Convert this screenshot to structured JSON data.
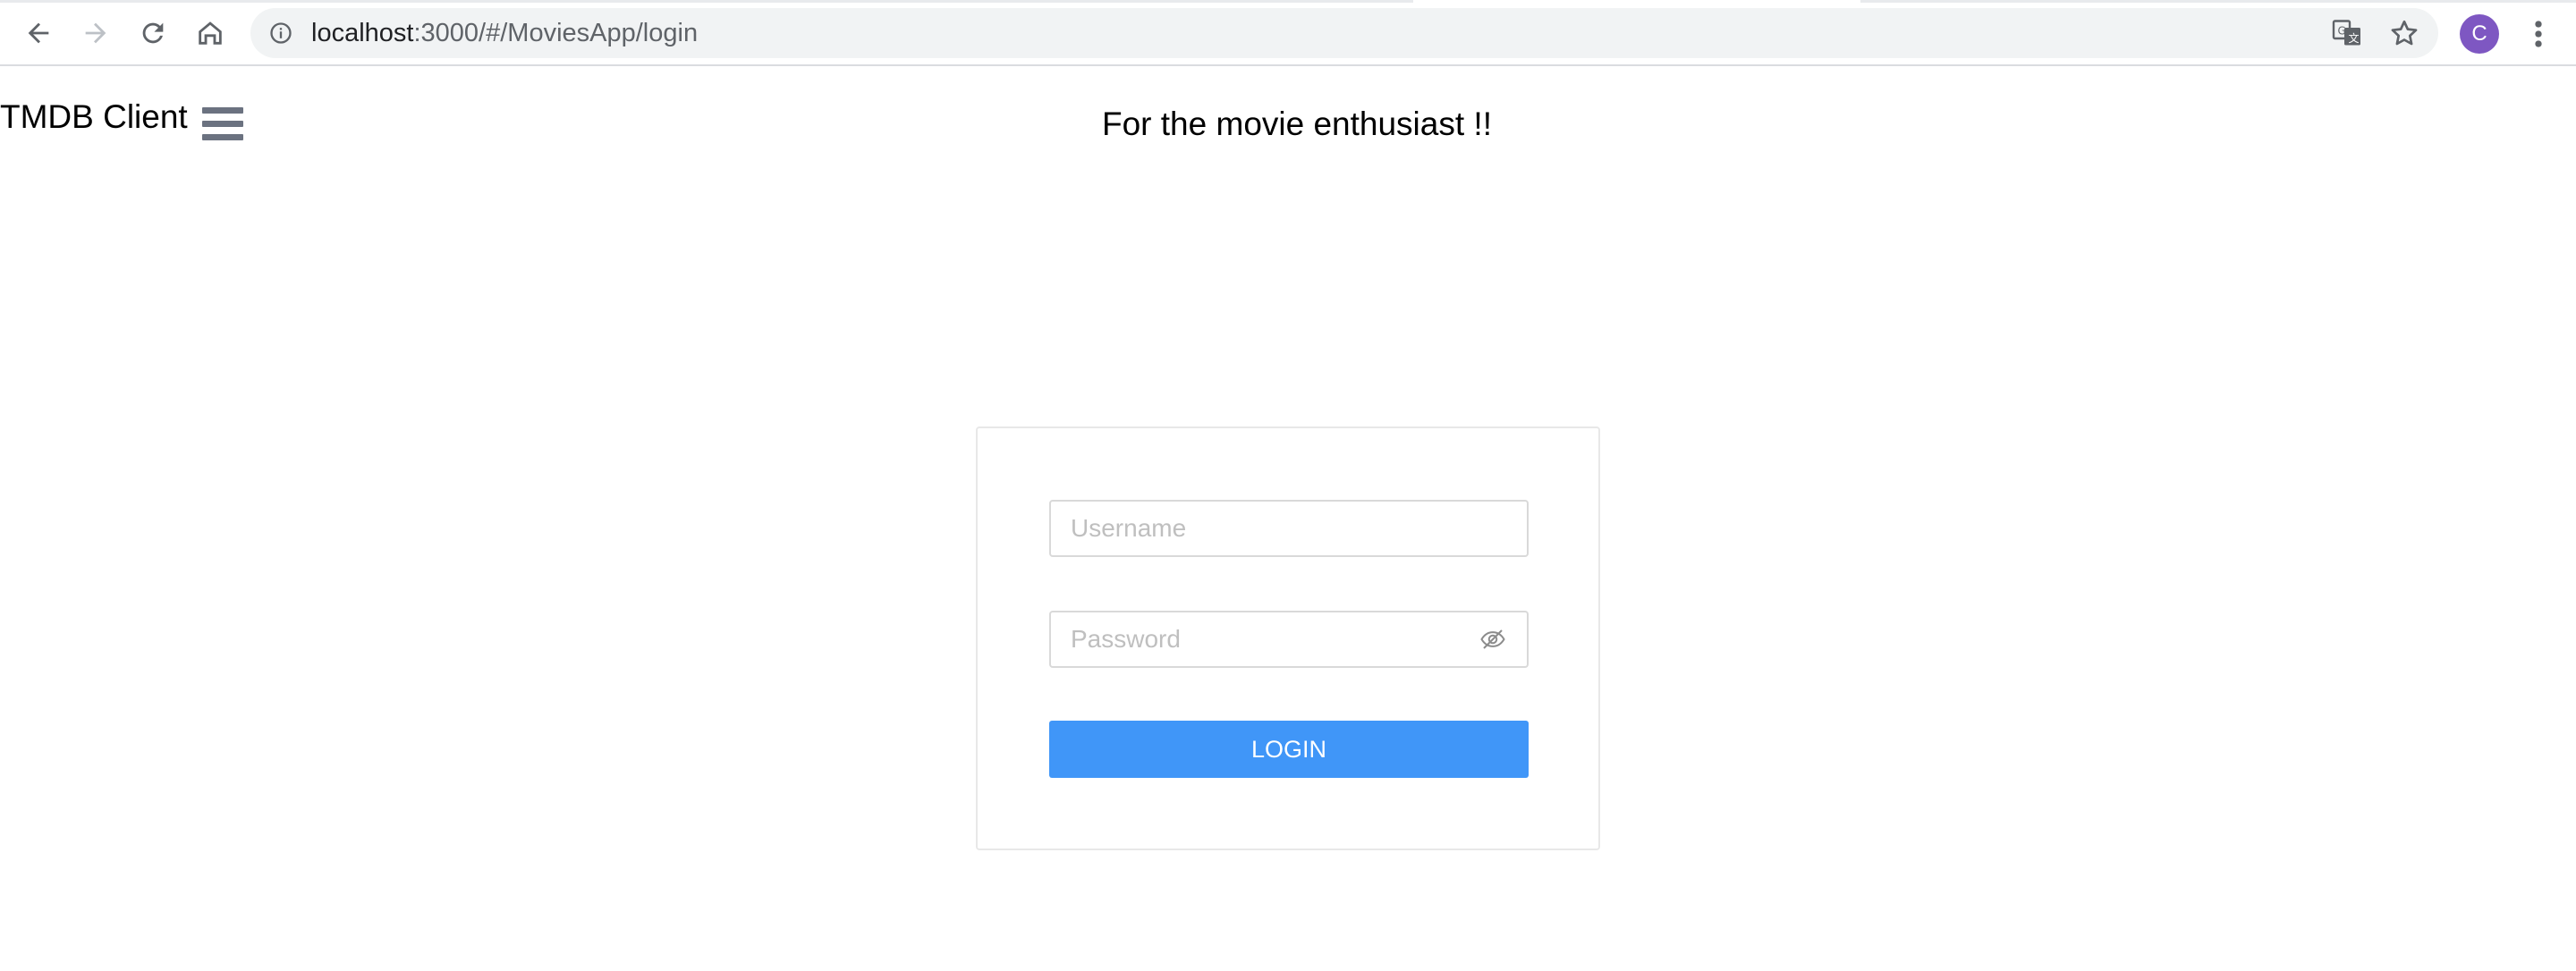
{
  "browser": {
    "url_host": "localhost",
    "url_path": ":3000/#/MoviesApp/login",
    "profile_initial": "C",
    "icons": [
      "back-icon",
      "forward-icon",
      "reload-icon",
      "home-icon",
      "info-icon",
      "translate-icon",
      "star-icon",
      "menu-dots-icon"
    ],
    "profile_color": "#7e57c2"
  },
  "app": {
    "title": "TMDB Client",
    "tagline": "For the movie enthusiast !!",
    "menu_icon": "hamburger-menu-icon"
  },
  "login": {
    "username_placeholder": "Username",
    "password_placeholder": "Password",
    "password_toggle_icon": "eye-invisible-icon",
    "login_label": "LOGIN",
    "accent_color": "#4096f8"
  }
}
